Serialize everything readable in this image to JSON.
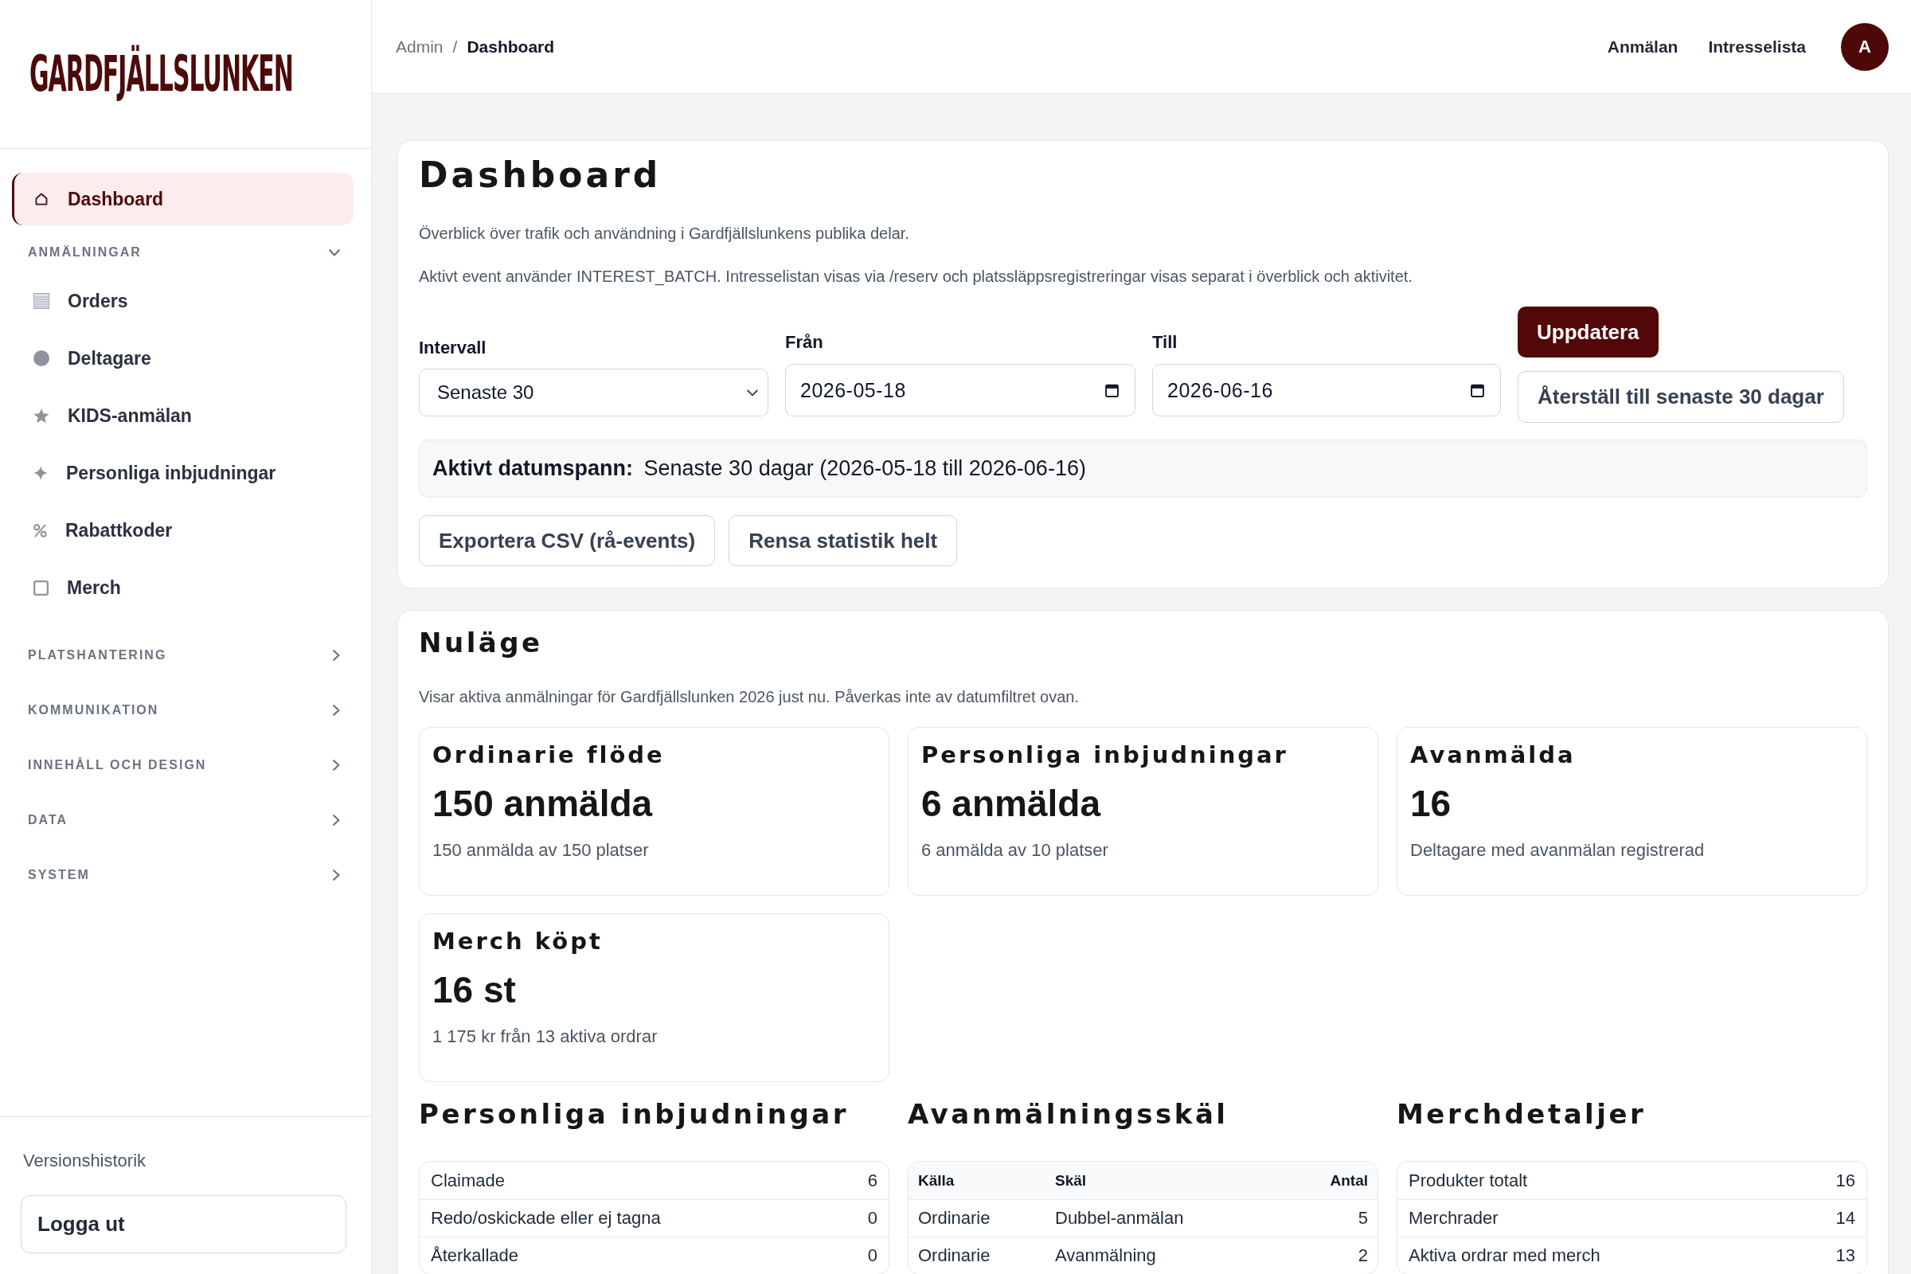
{
  "sidebar": {
    "logo": "GARDFJÄLLSLUNKEN",
    "top_items": [
      {
        "label": "Dashboard",
        "selected": true
      }
    ],
    "groups": [
      {
        "label": "ANMÄLNINGAR",
        "expanded": true,
        "items": [
          {
            "label": "Orders",
            "selected": false
          },
          {
            "label": "Deltagare",
            "selected": false
          },
          {
            "label": "KIDS-anmälan",
            "selected": false
          },
          {
            "label": "Personliga inbjudningar",
            "selected": false
          },
          {
            "label": "Rabattkoder",
            "selected": false
          },
          {
            "label": "Merch",
            "selected": false
          }
        ]
      },
      {
        "label": "PLATSHANTERING",
        "expanded": false
      },
      {
        "label": "KOMMUNIKATION",
        "expanded": false
      },
      {
        "label": "INNEHÅLL OCH DESIGN",
        "expanded": false
      },
      {
        "label": "DATA",
        "expanded": false
      },
      {
        "label": "SYSTEM",
        "expanded": false
      }
    ],
    "footer_link": "Versionshistorik",
    "logout_button": "Logga ut"
  },
  "header": {
    "breadcrumb": [
      {
        "label": "Admin",
        "current": false
      },
      {
        "label": "Dashboard",
        "current": true
      }
    ],
    "breadcrumb_separator": "/",
    "links": [
      "Anmälan",
      "Intresselista"
    ],
    "avatar": "A"
  },
  "dashboard": {
    "title": "Dashboard",
    "description": "Överblick över trafik och användning i Gardfjällslunkens publika delar.",
    "note": "Aktivt event använder INTEREST_BATCH. Intresselistan visas via /reserv och platssläppsregistreringar visas separat i överblick och aktivitet.",
    "filters": [
      {
        "kind": "select",
        "label": "Intervall",
        "value": "Senaste 30"
      },
      {
        "kind": "date",
        "label": "Från",
        "value": "2026-05-18"
      },
      {
        "kind": "date",
        "label": "Till",
        "value": "2026-06-16"
      }
    ],
    "buttons": [
      {
        "kind": "primary",
        "label": "Uppdatera"
      },
      {
        "kind": "secondary",
        "label": "Återställ till senaste 30 dagar"
      }
    ],
    "active_range": "**Aktivt datumspann:** Senaste 30 dagar (2026-05-18 till 2026-06-16)",
    "actions": [
      "Exportera CSV (rå-events)",
      "Rensa statistik helt"
    ]
  },
  "current_status": {
    "title": "Nuläge",
    "description": "Visar aktiva anmälningar för Gardfjällslunken 2026 just nu. Påverkas inte av datumfiltret ovan.",
    "cards": [
      {
        "title": "Ordinarie flöde",
        "value": "150 anmälda",
        "detail": "150 anmälda av 150 platser"
      },
      {
        "title": "Personliga inbjudningar",
        "value": "6 anmälda",
        "detail": "6 anmälda av 10 platser"
      },
      {
        "title": "Avanmälda",
        "value": "16",
        "detail": "Deltagare med avanmälan registrerad"
      },
      {
        "title": "Merch köpt",
        "value": "16 st",
        "detail": "1 175 kr från 13 aktiva ordrar"
      }
    ]
  },
  "invitations": {
    "title": "Personliga inbjudningar",
    "rows": [
      {
        "label": "Claimade",
        "value": "6"
      },
      {
        "label": "Redo/oskickade eller ej tagna",
        "value": "0"
      },
      {
        "label": "Återkallade",
        "value": "0"
      }
    ]
  },
  "cancellation_reasons": {
    "title": "Avanmälningsskäl",
    "columns": [
      "Källa",
      "Skäl",
      "Antal"
    ],
    "rows": [
      [
        "Ordinarie",
        "Dubbel-anmälan",
        "5"
      ],
      [
        "Ordinarie",
        "Avanmälning",
        "2"
      ]
    ]
  },
  "merch_details": {
    "title": "Merchdetaljer",
    "rows": [
      {
        "label": "Produkter totalt",
        "value": "16"
      },
      {
        "label": "Merchrader",
        "value": "14"
      },
      {
        "label": "Aktiva ordrar med merch",
        "value": "13"
      }
    ]
  }
}
